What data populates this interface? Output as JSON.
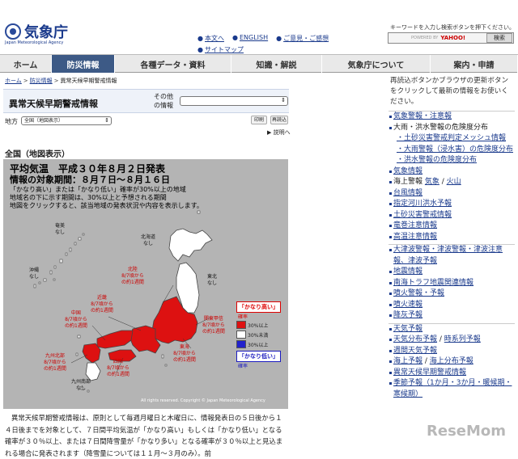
{
  "header": {
    "logo_name": "気象庁",
    "logo_sub": "Japan Meteorological Agency",
    "links_row1": [
      "本文へ",
      "ENGLISH",
      "ご意見・ご感想"
    ],
    "links_row2": [
      "サイトマップ"
    ],
    "search_hint": "キーワードを入力し検索ボタンを押下ください。",
    "search_powered": "POWERED BY",
    "search_logo": "YAHOO!",
    "search_button": "検索"
  },
  "nav": {
    "tabs": [
      "ホーム",
      "防災情報",
      "各種データ・資料",
      "知識・解説",
      "気象庁について",
      "案内・申請"
    ]
  },
  "breadcrumb": [
    "ホーム",
    "防災情報",
    "異常天候早期警戒情報"
  ],
  "page": {
    "title": "異常天候早期警戒情報",
    "other_info_label": "その他\nの情報",
    "region_label": "地方",
    "region_select": "全国（地図表示）",
    "print_button": "印刷",
    "reload_button": "再読込",
    "help_link": "説明へ",
    "section_heading": "全国（地図表示）"
  },
  "map": {
    "heading1": "平均気温　平成３０年８月２日発表",
    "heading2": "情報の対象期間：８月７日〜８月１６日",
    "heading3": "「かなり高い」または「かなり低い」確率が30%以上の地域",
    "heading4a": "地域名の下に示す期間は、30%以上と予想される期間",
    "heading4b": "地図をクリックすると、該当地域の発表状況や内容を表示します。",
    "copyright": "All rights reserved. Copyright © Japan Meteorological Agency",
    "regions": {
      "amami": [
        "奄美",
        "なし"
      ],
      "okinawa": [
        "沖縄",
        "なし"
      ],
      "hokkaido": [
        "北海道",
        "なし"
      ],
      "tohoku": [
        "東北",
        "なし"
      ],
      "hokuriku": [
        "北陸",
        "8/7頃から",
        "の約1週間"
      ],
      "kinki": [
        "近畿",
        "8/7頃から",
        "の約1週間"
      ],
      "chugoku": [
        "中国",
        "8/7頃から",
        "の約1週間"
      ],
      "kanto": [
        "関東甲信",
        "8/7頃から",
        "の約1週間"
      ],
      "tokai": [
        "東海",
        "8/7頃から",
        "の約1週間"
      ],
      "kyushu_n": [
        "九州北部",
        "8/7頃から",
        "の約1週間"
      ],
      "shikoku": [
        "四国",
        "8/7頃から",
        "の約1週間"
      ],
      "kyushu_s": [
        "九州南部",
        "なし"
      ]
    },
    "legend": {
      "high_header": "「かなり高い」",
      "high_sub": "確率",
      "row1": "30%以上",
      "row2": "30%未満",
      "row3": "30%以上",
      "low_header": "「かなり低い」",
      "low_sub": "確率",
      "colors": {
        "high": "#dd1111",
        "none": "#ffffff",
        "low": "#2222cc"
      }
    }
  },
  "body_text": "異常天候早期警戒情報は、原則として毎週月曜日と木曜日に、情報発表日の５日後から１４日後までを対象として、７日間平均気温が「かなり高い」もしくは「かなり低い」となる確率が３０％以上、または７日間降雪量が「かなり多い」となる確率が３０％以上と見込まれる場合に発表されます（降雪量については１１月〜３月のみ）。前",
  "sidebar": {
    "notice": "再読込ボタンかブラウザの更新ボタンをクリックして最新の情報をお使いください。",
    "groups": [
      [
        {
          "t": "気象警報・注意報",
          "c": "link"
        },
        {
          "t": "大雨・洪水警報の危険度分布",
          "c": "dark"
        },
        {
          "t": "・土砂災害警戒判定メッシュ情報",
          "c": "sublink"
        },
        {
          "t": "・大雨警報（浸水害）の危険度分布",
          "c": "sublink"
        },
        {
          "t": "・洪水警報の危険度分布",
          "c": "sublink"
        },
        {
          "t": "気象情報",
          "c": "link"
        },
        {
          "t": "海上警報",
          "c": "dark",
          "extra": [
            "気象",
            "火山"
          ]
        },
        {
          "t": "台風情報",
          "c": "link"
        },
        {
          "t": "指定河川洪水予報",
          "c": "link"
        },
        {
          "t": "土砂災害警戒情報",
          "c": "link"
        },
        {
          "t": "竜巻注意情報",
          "c": "link"
        },
        {
          "t": "高温注意情報",
          "c": "link"
        }
      ],
      [
        {
          "t": "大津波警報・津波警報・津波注意報、津波予報",
          "c": "link"
        },
        {
          "t": "地震情報",
          "c": "link"
        },
        {
          "t": "南海トラフ地震関連情報",
          "c": "link"
        },
        {
          "t": "噴火警報・予報",
          "c": "link"
        },
        {
          "t": "噴火速報",
          "c": "link"
        },
        {
          "t": "降灰予報",
          "c": "link"
        }
      ],
      [
        {
          "t": "天気予報",
          "c": "link"
        },
        {
          "t": "天気分布予報",
          "c": "link",
          "extra": [
            "時系列予報"
          ]
        },
        {
          "t": "週間天気予報",
          "c": "link"
        },
        {
          "t": "海上予報",
          "c": "link",
          "extra": [
            "海上分布予報"
          ]
        },
        {
          "t": "異常天候早期警戒情報",
          "c": "link"
        },
        {
          "t": "季節予報（1か月・3か月・暖候期・寒候期）",
          "c": "link"
        }
      ]
    ]
  },
  "watermark": "ReseMom"
}
